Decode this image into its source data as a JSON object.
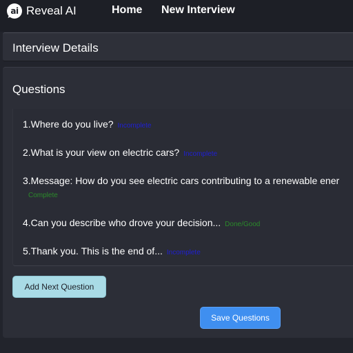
{
  "header": {
    "logo_text": "ai",
    "app_name": "Reveal AI",
    "nav": {
      "home": "Home",
      "new_interview": "New Interview"
    }
  },
  "details": {
    "title": "Interview Details"
  },
  "questions": {
    "heading": "Questions",
    "items": [
      {
        "text": "1.Where do you live?",
        "status": "Incomplete"
      },
      {
        "text": "2.What is your view on electric cars?",
        "status": "Incomplete"
      },
      {
        "text": "3.Message: How do you see electric cars contributing to a renewable ener",
        "status": "Complete"
      },
      {
        "text": "4.Can you describe who drove your decision...",
        "status": "Done/Good"
      },
      {
        "text": "5.Thank you. This is the end of...",
        "status": "Incomplete"
      }
    ]
  },
  "buttons": {
    "add_next": "Add Next Question",
    "save": "Save Questions"
  },
  "colors": {
    "background": "#22242c",
    "incomplete": "#1f1fd6",
    "complete": "#2a8a2a",
    "add_button": "#a9dbe6",
    "save_button": "#3f8ff0"
  }
}
